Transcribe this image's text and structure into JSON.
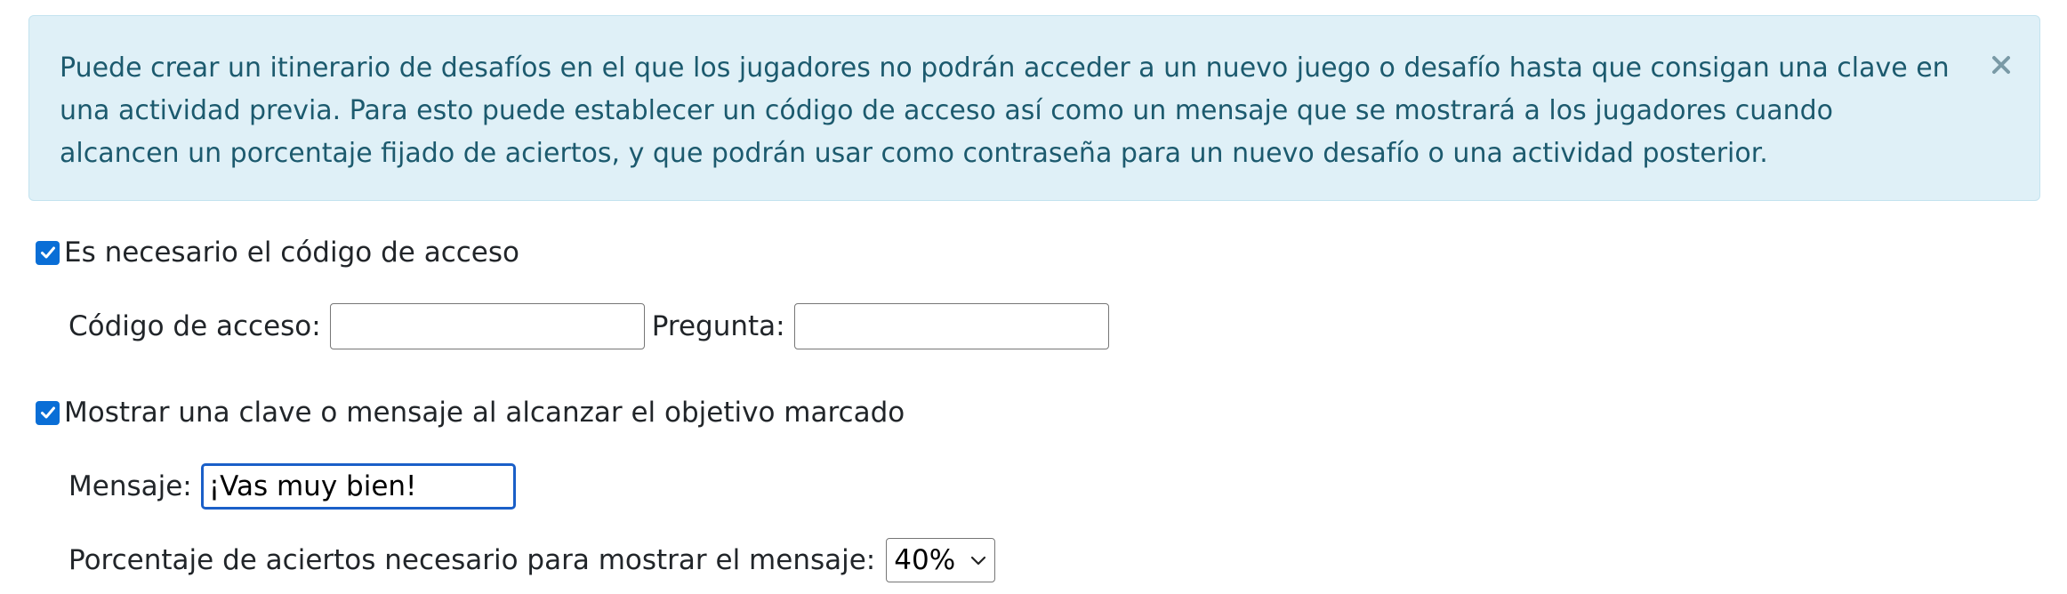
{
  "alert": {
    "text": "Puede crear un itinerario de desafíos en el que los jugadores no podrán acceder a un nuevo juego o desafío hasta que consigan una clave en una actividad previa. Para esto puede establecer un código de acceso así como un mensaje que se mostrará a los jugadores cuando alcancen un porcentaje fijado de aciertos, y que podrán usar como contraseña para un nuevo desafío o una actividad posterior.",
    "close_icon": "close-icon",
    "background": "#dff0f7",
    "text_color": "#1c5a6e"
  },
  "access_code": {
    "checkbox_label": "Es necesario el código de acceso",
    "checked": true,
    "code_label": "Código de acceso:",
    "code_value": "",
    "question_label": "Pregunta:",
    "question_value": ""
  },
  "message": {
    "checkbox_label": "Mostrar una clave o mensaje al alcanzar el objetivo marcado",
    "checked": true,
    "message_label": "Mensaje:",
    "message_value": "¡Vas muy bien!",
    "percentage_label": "Porcentaje de aciertos necesario para mostrar el mensaje:",
    "percentage_value": "40%"
  },
  "colors": {
    "checkbox": "#0a6ed6",
    "focus_border": "#1a5fc8"
  }
}
